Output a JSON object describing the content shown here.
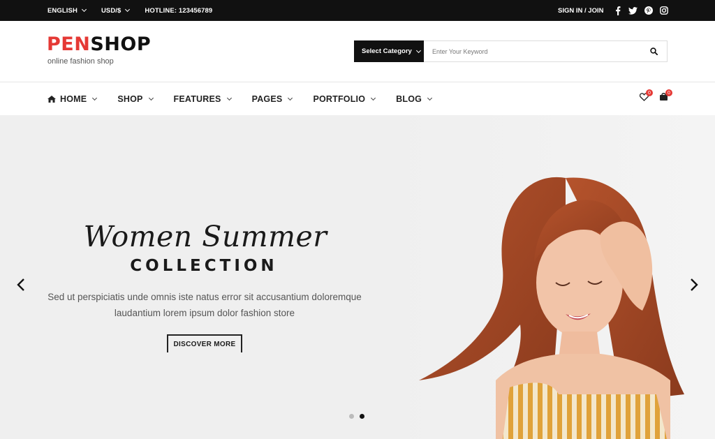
{
  "topbar": {
    "language": "ENGLISH",
    "currency": "USD/$",
    "hotline": "HOTLINE: 123456789",
    "signin": "SIGN IN / JOIN",
    "social": [
      "facebook-icon",
      "twitter-icon",
      "pinterest-icon",
      "instagram-icon"
    ]
  },
  "header": {
    "logo_part1": "PEN",
    "logo_part2": "SHOP",
    "tagline": "online fashion shop",
    "search": {
      "category": "Select Category",
      "placeholder": "Enter Your Keyword"
    }
  },
  "nav": {
    "items": [
      {
        "label": "HOME"
      },
      {
        "label": "SHOP"
      },
      {
        "label": "FEATURES"
      },
      {
        "label": "PAGES"
      },
      {
        "label": "PORTFOLIO"
      },
      {
        "label": "BLOG"
      }
    ],
    "wishlist_count": "0",
    "cart_count": "0"
  },
  "hero": {
    "title": "Women Summer",
    "subtitle": "COLLECTION",
    "description": "Sed ut perspiciatis unde omnis iste natus error sit accusantium doloremque laudantium lorem ipsum dolor fashion store",
    "cta": "DISCOVER MORE",
    "slides": 2,
    "active_slide": 2
  },
  "colors": {
    "accent": "#e53935",
    "dark": "#111111"
  }
}
